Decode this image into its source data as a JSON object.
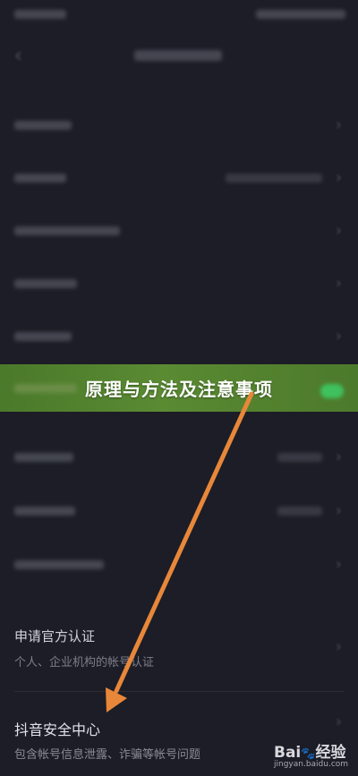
{
  "banner": {
    "title": "原理与方法及注意事项"
  },
  "apply": {
    "title": "申请官方认证",
    "subtitle": "个人、企业机构的帐号认证"
  },
  "safety": {
    "title": "抖音安全中心",
    "subtitle": "包含帐号信息泄露、诈骗等帐号问题"
  },
  "watermark": {
    "brand": "Bai",
    "brand2": "经验",
    "url": "jingyan.baidu.com"
  },
  "colors": {
    "background": "#1c1d26",
    "banner": "#558530",
    "arrow": "#e8873a",
    "toggle": "#3fc25e"
  }
}
